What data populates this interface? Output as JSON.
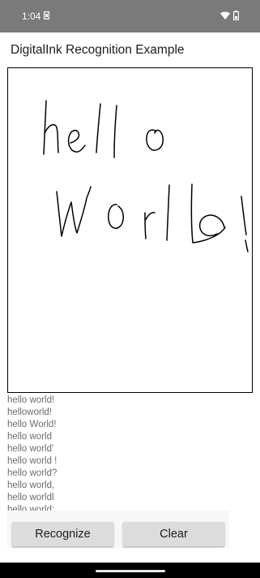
{
  "status_bar": {
    "time": "1:04",
    "icons": [
      "sim-card-icon",
      "wifi-icon",
      "battery-icon"
    ]
  },
  "app": {
    "title": "DigitalInk Recognition Example"
  },
  "canvas": {
    "ink_text": "hello world!"
  },
  "candidates": [
    "hello world!",
    "helloworld!",
    "hello World!",
    "hello world",
    "hello world'",
    "hello world !",
    "hello world?",
    "hello world,",
    "hello worldl",
    "hello world;"
  ],
  "buttons": {
    "recognize_label": "Recognize",
    "clear_label": "Clear"
  },
  "colors": {
    "status_bar": "#7a7a7a",
    "ink": "#000000",
    "candidate_text": "#6b6b6b",
    "button": "#dcdcdc"
  }
}
